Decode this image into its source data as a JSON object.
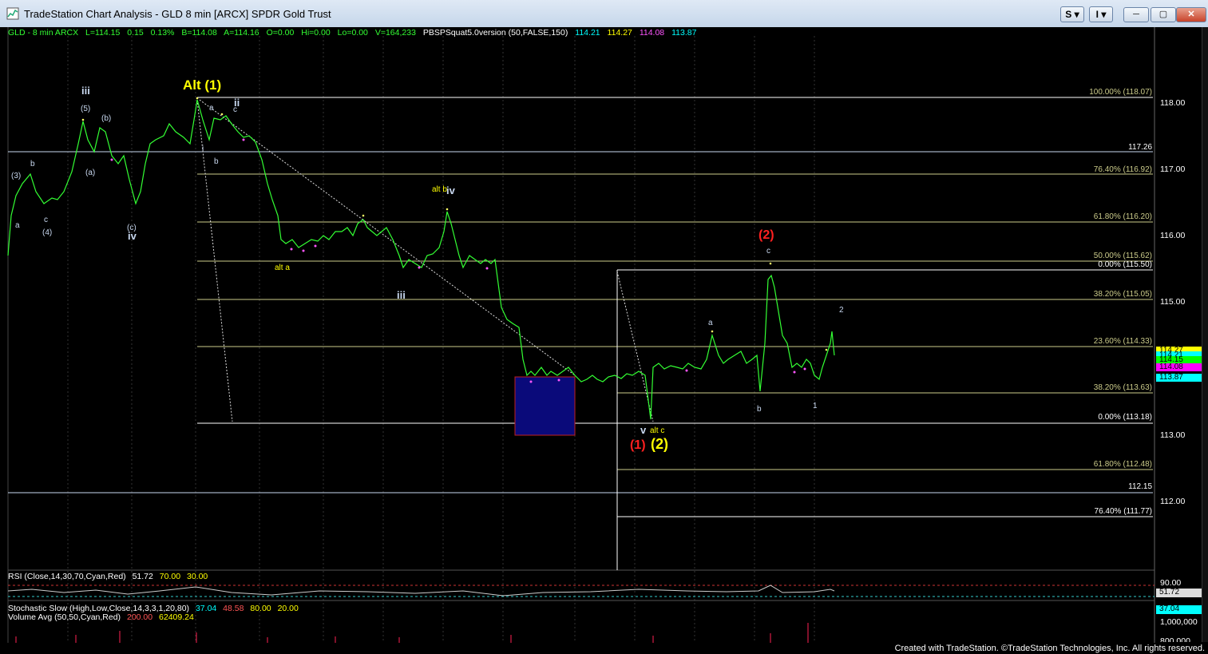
{
  "window": {
    "title": "TradeStation Chart Analysis - GLD 8 min [ARCX] SPDR Gold Trust",
    "s_button": "S",
    "i_button": "I",
    "minimize": "─",
    "maximize": "▢",
    "close": "✕"
  },
  "info_line": {
    "symbol": "GLD - 8 min  ARCX",
    "last": "L=114.15",
    "change": "0.15",
    "change_pct": "0.13%",
    "bid": "B=114.08",
    "ask": "A=114.16",
    "open": "O=0.00",
    "hi": "Hi=0.00",
    "lo": "Lo=0.00",
    "volume": "V=164,233",
    "indicator": "PBSPSquat5.0version (50,FALSE,150)",
    "v1": "114.21",
    "v2": "114.27",
    "v3": "114.08",
    "v4": "113.87"
  },
  "rsi": {
    "label": "RSI (Close,14,30,70,Cyan,Red)",
    "value": "51.72",
    "upper": "70.00",
    "lower": "30.00",
    "axis_top": "90.00",
    "box": "51.72"
  },
  "stoch": {
    "label": "Stochastic Slow (High,Low,Close,14,3,3,1,20,80)",
    "k": "37.04",
    "d": "48.58",
    "upper": "80.00",
    "lower": "20.00",
    "box": "37.04"
  },
  "volume": {
    "label": "Volume Avg (50,50,Cyan,Red)",
    "v1": "200.00",
    "v2": "62409.24",
    "axis": "1,000,000",
    "axis2": "800,000"
  },
  "price_ticks": [
    "118.00",
    "117.00",
    "116.00",
    "115.00",
    "113.00",
    "112.00"
  ],
  "price_boxes": [
    {
      "text": "114.27",
      "color": "#ffff00"
    },
    {
      "text": "114.21",
      "color": "#00ffff"
    },
    {
      "text": "114.15",
      "color": "#00ff00"
    },
    {
      "text": "114.08",
      "color": "#ff00ff"
    },
    {
      "text": "113.87",
      "color": "#00ffff"
    }
  ],
  "fib_labels": [
    "100.00% (118.07)",
    "117.26",
    "76.40% (116.92)",
    "61.80% (116.20)",
    "50.00% (115.62)",
    "0.00% (115.50)",
    "38.20% (115.05)",
    "23.60% (114.33)",
    "38.20% (113.63)",
    "0.00% (113.18)",
    "61.80% (112.48)",
    "112.15",
    "76.40% (111.77)"
  ],
  "waves": {
    "alt1": "Alt (1)",
    "iii_top": "iii",
    "w5": "(5)",
    "wb": "(b)",
    "wa": "(a)",
    "w3": "(3)",
    "b_small": "b",
    "a_small": "a",
    "c_small": "c",
    "w4": "(4)",
    "wc": "(c)",
    "iv_left": "iv",
    "a_alt": "a",
    "ii": "ii",
    "c_ii": "c",
    "i": "i",
    "b_i": "b",
    "alt_b": "alt b",
    "iv_mid": "iv",
    "alt_a": "alt a",
    "iii_mid": "iii",
    "v": "v",
    "alt_c": "alt c",
    "red1": "(1)",
    "yellow2": "(2)",
    "red2": "(2)",
    "c_red": "c",
    "a_right": "a",
    "b_right": "b",
    "one": "1",
    "two": "2"
  },
  "credit": "Created with TradeStation. ©TradeStation Technologies, Inc. All rights reserved.",
  "colors": {
    "price": "#33ff33",
    "fib": "#cbcb8a",
    "box": "#0a0a7a",
    "yellow": "#ffff00",
    "red": "#ff2020"
  }
}
